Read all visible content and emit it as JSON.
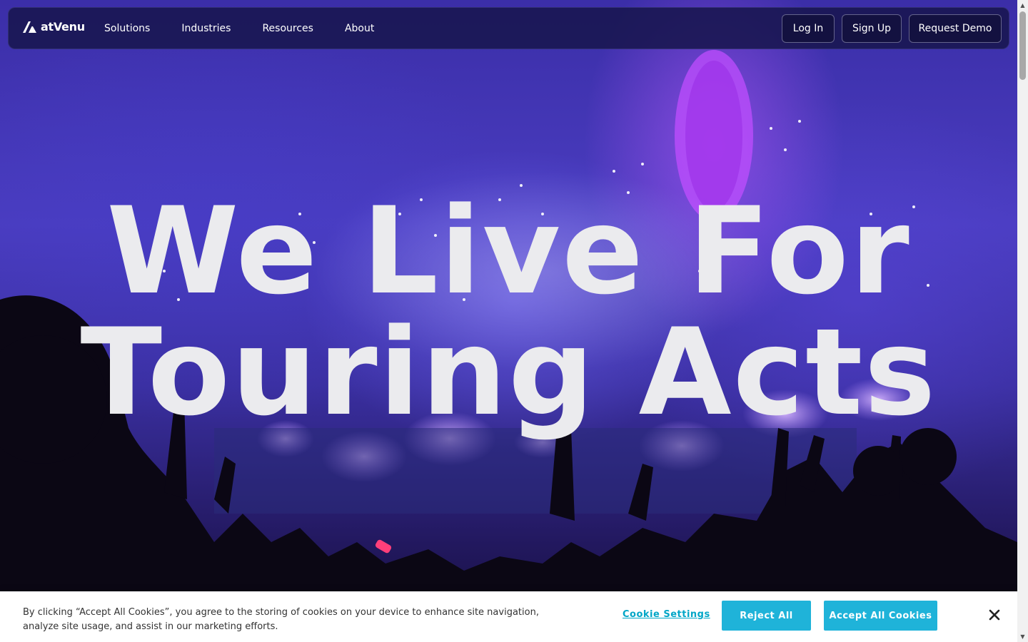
{
  "nav": {
    "logo_text": "atVenu",
    "links": [
      "Solutions",
      "Industries",
      "Resources",
      "About"
    ],
    "login_label": "Log In",
    "signup_label": "Sign Up",
    "demo_label": "Request Demo"
  },
  "hero": {
    "headline_line1": "We Live For",
    "headline_line2": "Touring Acts"
  },
  "cookie": {
    "text": "By clicking “Accept All Cookies”, you agree to the storing of cookies on your device to enhance site navigation, analyze site usage, and assist in our marketing efforts.",
    "settings_label": "Cookie Settings",
    "reject_label": "Reject All",
    "accept_label": "Accept All Cookies"
  },
  "icons": {
    "logo": "atvenu-logo-icon",
    "close": "close-icon"
  },
  "colors": {
    "accent_cyan": "#1fb3d9",
    "link_cyan": "#00a6c7",
    "nav_bg": "#18164e",
    "headline": "#ebebee"
  }
}
